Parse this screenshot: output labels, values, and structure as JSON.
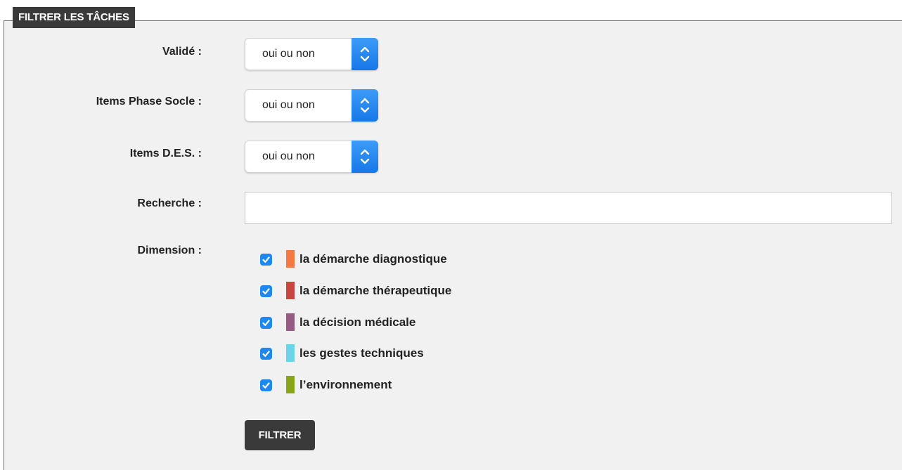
{
  "panel": {
    "legend": "FILTRER LES TÂCHES"
  },
  "filters": {
    "valide": {
      "label": "Validé :",
      "value": "oui ou non"
    },
    "phase_socle": {
      "label": "Items Phase Socle :",
      "value": "oui ou non"
    },
    "des": {
      "label": "Items D.E.S. :",
      "value": "oui ou non"
    },
    "recherche": {
      "label": "Recherche :",
      "value": "",
      "placeholder": ""
    },
    "dimension": {
      "label": "Dimension :",
      "items": [
        {
          "label": "la démarche diagnostique",
          "color": "#f47a45",
          "checked": true
        },
        {
          "label": "la démarche thérapeutique",
          "color": "#c64640",
          "checked": true
        },
        {
          "label": "la décision médicale",
          "color": "#955b82",
          "checked": true
        },
        {
          "label": "les gestes techniques",
          "color": "#6dd3ea",
          "checked": true
        },
        {
          "label": "l’environnement",
          "color": "#88a41a",
          "checked": true
        }
      ]
    }
  },
  "actions": {
    "filter_label": "FILTRER"
  },
  "colors": {
    "accent": "#1e88f0",
    "dark": "#3a3a3a",
    "panel_bg": "#f1f1f1"
  }
}
